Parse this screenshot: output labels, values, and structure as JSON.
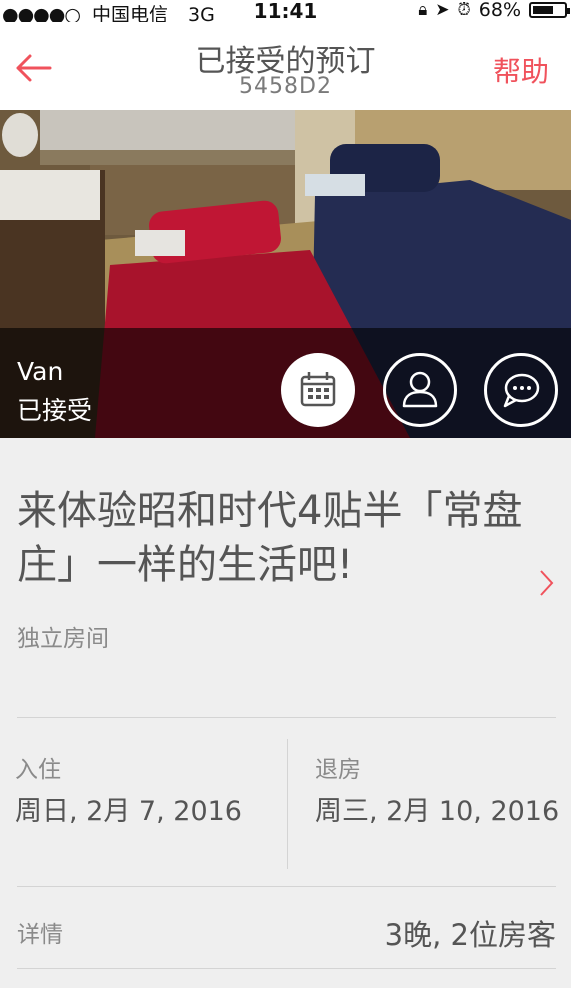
{
  "status_bar": {
    "signal": "●●●●○",
    "carrier": "中国电信",
    "network": "3G",
    "time": "11:41",
    "battery": "68%",
    "battery_level": 0.68
  },
  "nav": {
    "title": "已接受的预订",
    "code": "5458D2",
    "help": "帮助"
  },
  "host": {
    "name": "Van",
    "status": "已接受"
  },
  "listing": {
    "title": "来体验昭和时代4贴半「常盘庄」一样的生活吧!",
    "room_type": "独立房间"
  },
  "checkin": {
    "label": "入住",
    "value": "周日, 2月 7, 2016"
  },
  "checkout": {
    "label": "退房",
    "value": "周三, 2月 10, 2016"
  },
  "details": {
    "label": "详情",
    "value": "3晚, 2位房客"
  },
  "colors": {
    "accent": "#f0525c",
    "background": "#efefef"
  }
}
